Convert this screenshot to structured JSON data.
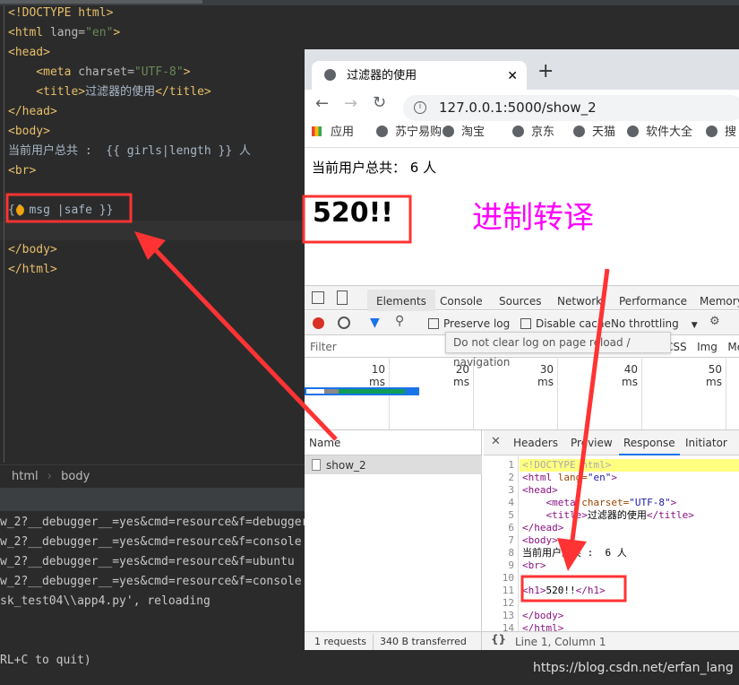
{
  "editor": {
    "lines": [
      {
        "parts": [
          {
            "t": "<!DOCTYPE html>",
            "c": "tag"
          }
        ]
      },
      {
        "parts": [
          {
            "t": "<html ",
            "c": "tag"
          },
          {
            "t": "lang=",
            "c": "attr"
          },
          {
            "t": "\"en\"",
            "c": "str"
          },
          {
            "t": ">",
            "c": "tag"
          }
        ]
      },
      {
        "parts": [
          {
            "t": "<head>",
            "c": "tag"
          }
        ]
      },
      {
        "parts": [
          {
            "t": "    <meta ",
            "c": "tag"
          },
          {
            "t": "charset=",
            "c": "attr"
          },
          {
            "t": "\"UTF-8\"",
            "c": "str"
          },
          {
            "t": ">",
            "c": "tag"
          }
        ]
      },
      {
        "parts": [
          {
            "t": "    <title>",
            "c": "tag"
          },
          {
            "t": "过滤器的使用",
            "c": ""
          },
          {
            "t": "</title>",
            "c": "tag"
          }
        ]
      },
      {
        "parts": [
          {
            "t": "</head>",
            "c": "tag"
          }
        ]
      },
      {
        "parts": [
          {
            "t": "<body>",
            "c": "tag"
          }
        ]
      },
      {
        "parts": [
          {
            "t": "当前用户总共 :  {{ girls|length }} 人",
            "c": ""
          }
        ]
      },
      {
        "parts": [
          {
            "t": "<br>",
            "c": "tag"
          }
        ]
      },
      {
        "parts": [
          {
            "t": "",
            "c": ""
          }
        ]
      },
      {
        "parts": [
          {
            "t": "{{ msg |safe }}",
            "c": ""
          }
        ]
      },
      {
        "parts": [
          {
            "t": "",
            "c": ""
          }
        ]
      },
      {
        "parts": [
          {
            "t": "</body>",
            "c": "tag"
          }
        ]
      },
      {
        "parts": [
          {
            "t": "</html>",
            "c": "tag"
          }
        ]
      }
    ],
    "breadcrumb": [
      "html",
      "body"
    ]
  },
  "terminal": {
    "lines": [
      "w_2?__debugger__=yes&cmd=resource&f=debugger",
      "w_2?__debugger__=yes&cmd=resource&f=console",
      "w_2?__debugger__=yes&cmd=resource&f=ubuntu",
      "w_2?__debugger__=yes&cmd=resource&f=console",
      "sk_test04\\\\app4.py', reloading",
      "",
      "",
      "RL+C to quit)"
    ]
  },
  "browser": {
    "tab_title": "过滤器的使用",
    "url": "127.0.0.1:5000/show_2",
    "bookmarks": [
      "应用",
      "苏宁易购",
      "淘宝",
      "京东",
      "天猫",
      "软件大全",
      "搜"
    ],
    "page": {
      "user_count_text": "当前用户总共： 6 人",
      "h1": "520!!",
      "annotation": "进制转译",
      "annotation_color": "#ff00ff"
    }
  },
  "devtools": {
    "tabs": [
      "Elements",
      "Console",
      "Sources",
      "Network",
      "Performance",
      "Memory"
    ],
    "active_tab": "Network",
    "preserve_log": "Preserve log",
    "disable_cache": "Disable cache",
    "throttling": "No throttling",
    "filter_placeholder": "Filter",
    "tooltip": "Do not clear log on page reload / navigation",
    "filter_types": [
      "CSS",
      "Img",
      "Med"
    ],
    "timeline_ticks": [
      "10 ms",
      "20 ms",
      "30 ms",
      "40 ms",
      "50 ms"
    ],
    "name_header": "Name",
    "requests": [
      {
        "name": "show_2"
      }
    ],
    "detail_tabs": [
      "Headers",
      "Preview",
      "Response",
      "Initiator"
    ],
    "active_detail_tab": "Response",
    "response_lines": [
      [
        {
          "t": "<!DOCTYPE html>",
          "c": "#aaa"
        }
      ],
      [
        {
          "t": "<html ",
          "c": "#881280"
        },
        {
          "t": "lang=",
          "c": "#994500"
        },
        {
          "t": "\"en\"",
          "c": "#1a1aa6"
        },
        {
          "t": ">",
          "c": "#881280"
        }
      ],
      [
        {
          "t": "<head>",
          "c": "#881280"
        }
      ],
      [
        {
          "t": "    <meta ",
          "c": "#881280"
        },
        {
          "t": "charset=",
          "c": "#994500"
        },
        {
          "t": "\"UTF-8\"",
          "c": "#1a1aa6"
        },
        {
          "t": ">",
          "c": "#881280"
        }
      ],
      [
        {
          "t": "    <title>",
          "c": "#881280"
        },
        {
          "t": "过滤器的使用",
          "c": "#000"
        },
        {
          "t": "</title>",
          "c": "#881280"
        }
      ],
      [
        {
          "t": "</head>",
          "c": "#881280"
        }
      ],
      [
        {
          "t": "<body>",
          "c": "#881280"
        }
      ],
      [
        {
          "t": "当前用户总共 :  6 人",
          "c": "#000"
        }
      ],
      [
        {
          "t": "<br>",
          "c": "#881280"
        }
      ],
      [
        {
          "t": "",
          "c": "#000"
        }
      ],
      [
        {
          "t": "<h1>",
          "c": "#881280"
        },
        {
          "t": "520!!",
          "c": "#000"
        },
        {
          "t": "</h1>",
          "c": "#881280"
        }
      ],
      [
        {
          "t": "",
          "c": "#000"
        }
      ],
      [
        {
          "t": "</body>",
          "c": "#881280"
        }
      ],
      [
        {
          "t": "</html>",
          "c": "#881280"
        }
      ]
    ],
    "status_requests": "1 requests",
    "status_transferred": "340 B transferred",
    "cursor_pos": "Line 1, Column 1"
  },
  "watermark": "https://blog.csdn.net/erfan_lang"
}
